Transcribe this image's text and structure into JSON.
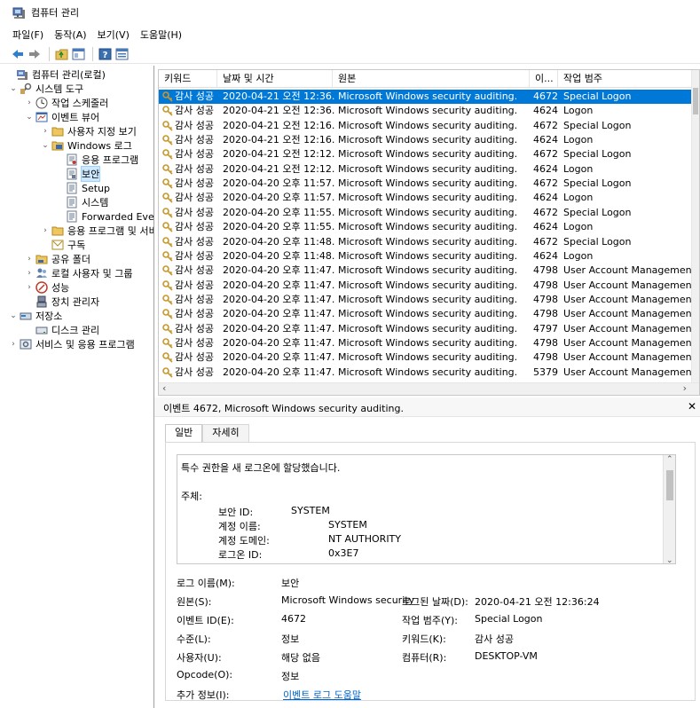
{
  "window": {
    "title": "컴퓨터 관리"
  },
  "menu": [
    "파일(F)",
    "동작(A)",
    "보기(V)",
    "도움말(H)"
  ],
  "toolbar": {
    "icons": [
      "back-arrow-icon",
      "forward-arrow-icon",
      "up-folder-icon",
      "console-tree-icon",
      "help-icon",
      "properties-icon"
    ]
  },
  "tree": [
    {
      "label": "컴퓨터 관리(로컬)",
      "icon": "computer-management-icon"
    },
    {
      "label": "시스템 도구",
      "icon": "system-tools-icon"
    },
    {
      "label": "작업 스케줄러",
      "icon": "clock-icon"
    },
    {
      "label": "이벤트 뷰어",
      "icon": "event-viewer-icon"
    },
    {
      "label": "사용자 지정 보기",
      "icon": "folder-icon"
    },
    {
      "label": "Windows 로그",
      "icon": "folder-icon"
    },
    {
      "label": "응용 프로그램",
      "icon": "log-icon"
    },
    {
      "label": "보안",
      "icon": "log-icon"
    },
    {
      "label": "Setup",
      "icon": "log-icon"
    },
    {
      "label": "시스템",
      "icon": "log-icon"
    },
    {
      "label": "Forwarded Events",
      "icon": "log-icon"
    },
    {
      "label": "응용 프로그램 및 서비스 로그",
      "icon": "folder-icon"
    },
    {
      "label": "구독",
      "icon": "subscription-icon"
    },
    {
      "label": "공유 폴더",
      "icon": "shared-folder-icon"
    },
    {
      "label": "로컬 사용자 및 그룹",
      "icon": "users-icon"
    },
    {
      "label": "성능",
      "icon": "performance-icon"
    },
    {
      "label": "장치 관리자",
      "icon": "device-manager-icon"
    },
    {
      "label": "저장소",
      "icon": "storage-icon"
    },
    {
      "label": "디스크 관리",
      "icon": "disk-icon"
    },
    {
      "label": "서비스 및 응용 프로그램",
      "icon": "services-icon"
    }
  ],
  "table": {
    "columns": [
      "키워드",
      "날짜 및 시간",
      "원본",
      "이...",
      "작업 범주"
    ],
    "rows": [
      [
        "감사 성공",
        "2020-04-21 오전 12:36...",
        "Microsoft Windows security auditing.",
        "4672",
        "Special Logon"
      ],
      [
        "감사 성공",
        "2020-04-21 오전 12:36...",
        "Microsoft Windows security auditing.",
        "4624",
        "Logon"
      ],
      [
        "감사 성공",
        "2020-04-21 오전 12:16...",
        "Microsoft Windows security auditing.",
        "4672",
        "Special Logon"
      ],
      [
        "감사 성공",
        "2020-04-21 오전 12:16...",
        "Microsoft Windows security auditing.",
        "4624",
        "Logon"
      ],
      [
        "감사 성공",
        "2020-04-21 오전 12:12...",
        "Microsoft Windows security auditing.",
        "4672",
        "Special Logon"
      ],
      [
        "감사 성공",
        "2020-04-21 오전 12:12...",
        "Microsoft Windows security auditing.",
        "4624",
        "Logon"
      ],
      [
        "감사 성공",
        "2020-04-20 오후 11:57...",
        "Microsoft Windows security auditing.",
        "4672",
        "Special Logon"
      ],
      [
        "감사 성공",
        "2020-04-20 오후 11:57...",
        "Microsoft Windows security auditing.",
        "4624",
        "Logon"
      ],
      [
        "감사 성공",
        "2020-04-20 오후 11:55...",
        "Microsoft Windows security auditing.",
        "4672",
        "Special Logon"
      ],
      [
        "감사 성공",
        "2020-04-20 오후 11:55...",
        "Microsoft Windows security auditing.",
        "4624",
        "Logon"
      ],
      [
        "감사 성공",
        "2020-04-20 오후 11:48...",
        "Microsoft Windows security auditing.",
        "4672",
        "Special Logon"
      ],
      [
        "감사 성공",
        "2020-04-20 오후 11:48...",
        "Microsoft Windows security auditing.",
        "4624",
        "Logon"
      ],
      [
        "감사 성공",
        "2020-04-20 오후 11:47...",
        "Microsoft Windows security auditing.",
        "4798",
        "User Account Management"
      ],
      [
        "감사 성공",
        "2020-04-20 오후 11:47...",
        "Microsoft Windows security auditing.",
        "4798",
        "User Account Management"
      ],
      [
        "감사 성공",
        "2020-04-20 오후 11:47...",
        "Microsoft Windows security auditing.",
        "4798",
        "User Account Management"
      ],
      [
        "감사 성공",
        "2020-04-20 오후 11:47...",
        "Microsoft Windows security auditing.",
        "4798",
        "User Account Management"
      ],
      [
        "감사 성공",
        "2020-04-20 오후 11:47...",
        "Microsoft Windows security auditing.",
        "4797",
        "User Account Management"
      ],
      [
        "감사 성공",
        "2020-04-20 오후 11:47...",
        "Microsoft Windows security auditing.",
        "4798",
        "User Account Management"
      ],
      [
        "감사 성공",
        "2020-04-20 오후 11:47...",
        "Microsoft Windows security auditing.",
        "4798",
        "User Account Management"
      ],
      [
        "감사 성공",
        "2020-04-20 오후 11:47...",
        "Microsoft Windows security auditing.",
        "5379",
        "User Account Management"
      ]
    ]
  },
  "detail": {
    "title": "이벤트 4672, Microsoft Windows security auditing.",
    "tabs": [
      "일반",
      "자세히"
    ],
    "message": {
      "line1": "특수 권한을 새 로그온에 할당했습니다.",
      "subject_label": "주체:",
      "security_id_label": "보안 ID:",
      "security_id": "SYSTEM",
      "account_name_label": "계정 이름:",
      "account_name": "SYSTEM",
      "account_domain_label": "계정 도메인:",
      "account_domain": "NT AUTHORITY",
      "logon_id_label": "로그온 ID:",
      "logon_id": "0x3E7"
    },
    "props": {
      "log_name_label": "로그 이름(M):",
      "log_name": "보안",
      "source_label": "원본(S):",
      "source": "Microsoft Windows security",
      "logged_label": "로그된 날짜(D):",
      "logged": "2020-04-21 오전 12:36:24",
      "event_id_label": "이벤트 ID(E):",
      "event_id": "4672",
      "category_label": "작업 범주(Y):",
      "category": "Special Logon",
      "level_label": "수준(L):",
      "level": "정보",
      "keywords_label": "키워드(K):",
      "keywords": "감사 성공",
      "user_label": "사용자(U):",
      "user": "해당 없음",
      "computer_label": "컴퓨터(R):",
      "computer": "DESKTOP-VM",
      "opcode_label": "Opcode(O):",
      "opcode": "정보",
      "more_info_label": "추가 정보(I):",
      "more_info_link": "이벤트 로그 도움말"
    }
  },
  "colors": {
    "selection": "#0078d7",
    "link": "#0066cc",
    "tree_highlight": "#cce8ff"
  }
}
